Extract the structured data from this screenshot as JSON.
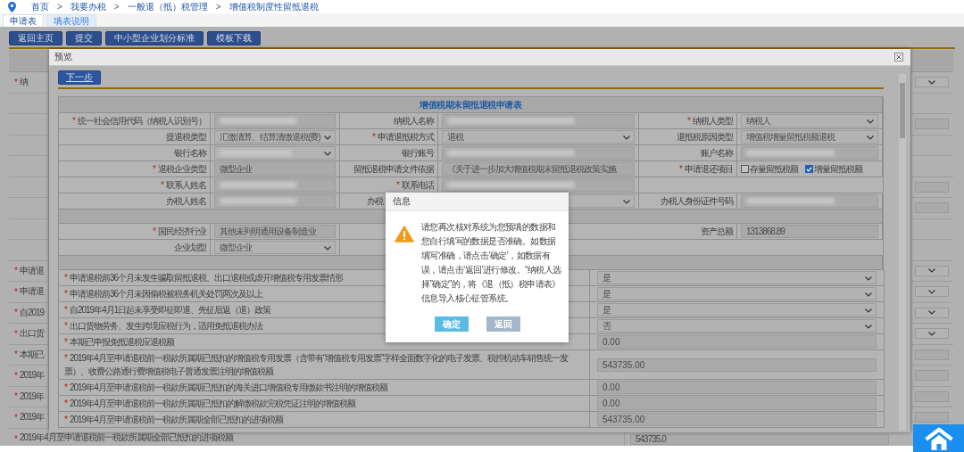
{
  "breadcrumb": [
    {
      "kind": "link",
      "text": "首页"
    },
    {
      "kind": "sep",
      "text": ">"
    },
    {
      "kind": "link",
      "text": "我要办税"
    },
    {
      "kind": "sep",
      "text": ">"
    },
    {
      "kind": "link",
      "text": "一般退（抵）税管理"
    },
    {
      "kind": "sep",
      "text": ">"
    },
    {
      "kind": "link",
      "text": "增值税制度性留抵退税"
    }
  ],
  "tabs": [
    {
      "label": "申请表",
      "selected": true
    },
    {
      "label": "填表说明",
      "selected": false
    }
  ],
  "toolbar": [
    "返回主页",
    "提交",
    "中小型企业划分标准",
    "模板下载"
  ],
  "background_form": {
    "rows": [
      {
        "mark": "*",
        "label": "纳",
        "kind": "select"
      },
      {
        "kind": "plain"
      },
      {
        "kind": "input"
      },
      {
        "kind": "plain"
      },
      {
        "kind": "plain"
      },
      {
        "kind": "input"
      },
      {
        "kind": "input"
      },
      {
        "kind": "plain"
      },
      {
        "kind": "plain"
      },
      {
        "mark": "*",
        "label": "申请退",
        "kind": "select"
      },
      {
        "mark": "*",
        "label": "申请退",
        "kind": "select"
      },
      {
        "mark": "*",
        "label": "自2019",
        "kind": "select"
      },
      {
        "mark": "*",
        "label": "出口货",
        "kind": "select"
      },
      {
        "mark": "*",
        "label": "本期已",
        "kind": "input"
      },
      {
        "mark": "*",
        "label": "2019年",
        "kind": "input"
      },
      {
        "mark": "*",
        "label": "2019年",
        "kind": "input"
      },
      {
        "mark": "*",
        "label": "2019年",
        "kind": "input"
      }
    ],
    "last_row": {
      "mark": "*",
      "label": "2019年4月至申请退税前一税款所属期全部已抵扣的进项税额",
      "value": "543735.0"
    }
  },
  "modal": {
    "title": "预览",
    "next_button": "下一步",
    "form": {
      "title": "增值税期末留抵退税申请表",
      "rows": [
        {
          "kind": "fields",
          "cells": [
            {
              "kind": "label",
              "mark": "*",
              "text": "统一社会信用代码（纳税人识别号）"
            },
            {
              "kind": "input",
              "redacted": true
            },
            {
              "kind": "label",
              "text": "纳税人名称"
            },
            {
              "kind": "input",
              "redacted": true
            },
            {
              "kind": "label",
              "mark": "*",
              "text": "纳税人类型"
            },
            {
              "kind": "select",
              "value": "纳税人"
            }
          ]
        },
        {
          "kind": "fields",
          "cells": [
            {
              "kind": "label",
              "text": "提退税类型"
            },
            {
              "kind": "select",
              "value": "汇缴清算、结算清缴退税(费)"
            },
            {
              "kind": "label",
              "mark": "*",
              "text": "申请退抵税方式"
            },
            {
              "kind": "select",
              "value": "退税"
            },
            {
              "kind": "label",
              "text": "退抵税原因类型"
            },
            {
              "kind": "select",
              "value": "增值税增量留抵税额退税"
            }
          ]
        },
        {
          "kind": "fields",
          "cells": [
            {
              "kind": "label",
              "text": "银行名称"
            },
            {
              "kind": "select",
              "redacted": true
            },
            {
              "kind": "label",
              "text": "银行账号"
            },
            {
              "kind": "input",
              "redacted": true
            },
            {
              "kind": "label",
              "text": "账户名称"
            },
            {
              "kind": "input",
              "redacted": true
            }
          ]
        },
        {
          "kind": "fields",
          "cells": [
            {
              "kind": "label",
              "mark": "*",
              "text": "退税企业类型"
            },
            {
              "kind": "input",
              "value": "微型企业"
            },
            {
              "kind": "label",
              "text": "留抵退税申请文件依据"
            },
            {
              "kind": "input",
              "value": "《关于进一步加大增值税期末留抵退税政策实施"
            },
            {
              "kind": "label",
              "mark": "*",
              "text": "申请退还项目"
            },
            {
              "kind": "checks",
              "options": [
                {
                  "label": "存量留抵税额",
                  "checked": false
                },
                {
                  "label": "增量留抵税额",
                  "checked": true
                }
              ]
            }
          ]
        },
        {
          "kind": "fields",
          "cells": [
            {
              "kind": "label",
              "mark": "*",
              "text": "联系人姓名"
            },
            {
              "kind": "input",
              "redacted": true
            },
            {
              "kind": "label",
              "mark": "*",
              "text": "联系电话"
            },
            {
              "kind": "input",
              "redacted": true
            },
            {
              "kind": "empty"
            }
          ]
        },
        {
          "kind": "fields",
          "cells": [
            {
              "kind": "label",
              "text": "办税人姓名"
            },
            {
              "kind": "input",
              "redacted": true
            },
            {
              "kind": "label",
              "text": "办税",
              "cut": true
            },
            {
              "kind": "select"
            },
            {
              "kind": "label",
              "text": "办税人身份证件号码"
            },
            {
              "kind": "input",
              "redacted": true
            }
          ]
        },
        {
          "kind": "section"
        },
        {
          "kind": "fields",
          "cells": [
            {
              "kind": "label",
              "mark": "*",
              "text": "国民经济行业"
            },
            {
              "kind": "input",
              "value": "其他未列明通用设备制造业"
            },
            {
              "kind": "empty"
            },
            {
              "kind": "empty"
            },
            {
              "kind": "label",
              "text": "资产总额"
            },
            {
              "kind": "input",
              "value": "1313868.89"
            }
          ]
        },
        {
          "kind": "fields",
          "cells": [
            {
              "kind": "label",
              "text": "企业划型"
            },
            {
              "kind": "select",
              "value": "微型企业"
            },
            {
              "kind": "empty"
            }
          ]
        },
        {
          "kind": "section"
        }
      ]
    },
    "questions": [
      {
        "mark": "*",
        "text": "申请退税前36个月未发生骗取留抵退税、出口退税或虚开增值税专用发票情形",
        "control": {
          "kind": "select",
          "value": "是"
        }
      },
      {
        "mark": "*",
        "text": "申请退税前36个月未因偷税被税务机关处罚两次及以上",
        "control": {
          "kind": "select",
          "value": "是"
        }
      },
      {
        "mark": "*",
        "text": "自2019年4月1日起未享受即征即退、先征后返（退）政策",
        "control": {
          "kind": "select",
          "value": "是"
        }
      },
      {
        "mark": "*",
        "text": "出口货物劳务、发生跨境应税行为，适用免抵退税办法",
        "control": {
          "kind": "select",
          "value": "否"
        }
      },
      {
        "mark": "*",
        "text": "本期已申报免抵退税应退税额",
        "control": {
          "kind": "input",
          "value": "0.00"
        }
      },
      {
        "mark": "*",
        "text": "2019年4月至申请退税前一税款所属期已抵扣的增值税专用发票（含带有“增值税专用发票”字样全面数字化的电子发票、税控机动车销售统一发票）、收费公路通行费增值税电子普通发票注明的增值税额",
        "control": {
          "kind": "input",
          "value": "543735.00"
        }
      },
      {
        "mark": "*",
        "text": "2019年4月至申请退税前一税款所属期已抵扣的海关进口增值税专用缴款书注明的增值税额",
        "control": {
          "kind": "input",
          "value": "0.00"
        }
      },
      {
        "mark": "*",
        "text": "2019年4月至申请退税前一税款所属期已抵扣的解缴税款完税凭证注明的增值税额",
        "control": {
          "kind": "input",
          "value": "0.00"
        }
      },
      {
        "mark": "*",
        "text": "2019年4月至申请退税前一税款所属期全部已抵扣的进项税额",
        "control": {
          "kind": "input",
          "value": "543735.00"
        }
      }
    ]
  },
  "dialog": {
    "title": "信息",
    "message": "请您再次核对系统为您预填的数据和您自行填写的数据是否准确。如数据填写准确，请点击‘确定’，如数据有误，请点击‘返回’进行修改。“纳税人选择”确定”的，将《退（抵）税申请表》信息导入核心征管系统。",
    "buttons": [
      {
        "label": "确定",
        "kind": "primary"
      },
      {
        "label": "返回",
        "kind": "secondary"
      }
    ]
  }
}
